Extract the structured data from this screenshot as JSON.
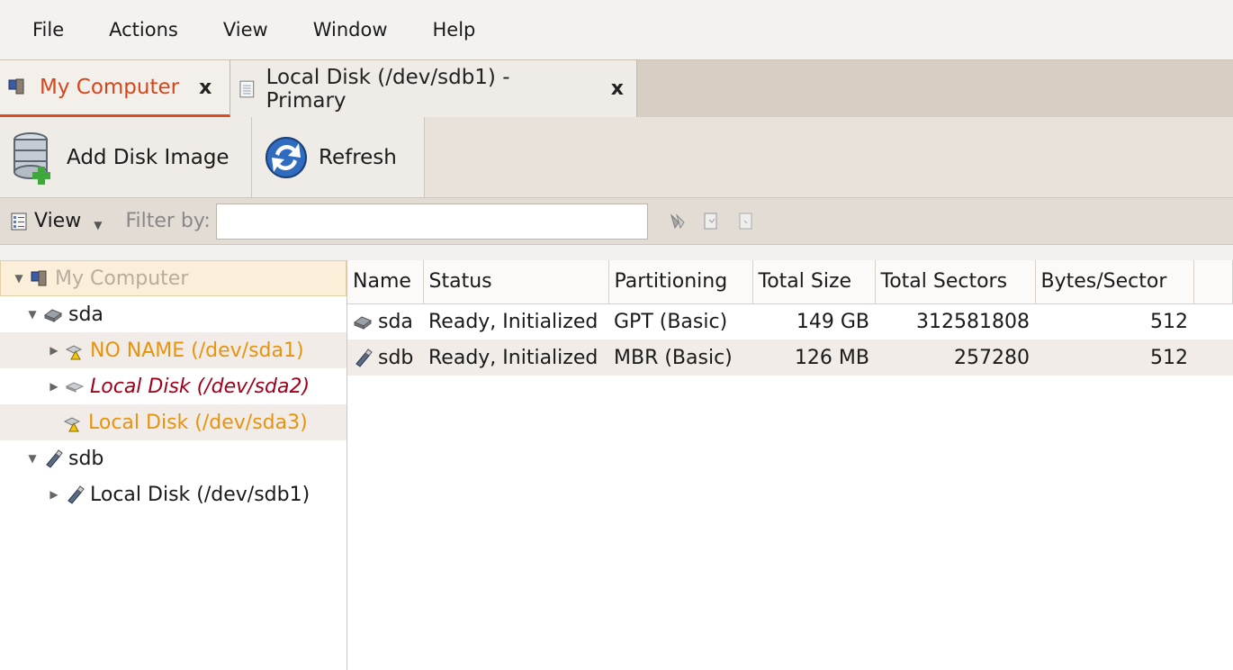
{
  "menu": {
    "items": [
      {
        "label": "File"
      },
      {
        "label": "Actions"
      },
      {
        "label": "View"
      },
      {
        "label": "Window"
      },
      {
        "label": "Help"
      }
    ]
  },
  "tabs": [
    {
      "label": "My Computer",
      "close": "x"
    },
    {
      "label": "Local Disk (/dev/sdb1) - Primary",
      "close": "x"
    }
  ],
  "toolbar": {
    "add_disk_image": "Add Disk Image",
    "refresh": "Refresh"
  },
  "filterbar": {
    "view_label": "View",
    "filter_label": "Filter by:",
    "filter_value": ""
  },
  "tree": {
    "root": "My Computer",
    "sda": "sda",
    "sda1": "NO NAME (/dev/sda1)",
    "sda2": "Local Disk (/dev/sda2)",
    "sda3": "Local Disk (/dev/sda3)",
    "sdb": "sdb",
    "sdb1": "Local Disk (/dev/sdb1)"
  },
  "table": {
    "headers": [
      "Name",
      "Status",
      "Partitioning",
      "Total Size",
      "Total Sectors",
      "Bytes/Sector"
    ],
    "rows": [
      {
        "name": "sda",
        "status": "Ready, Initialized",
        "partitioning": "GPT (Basic)",
        "size": "149 GB",
        "sectors": "312581808",
        "bytes": "512"
      },
      {
        "name": "sdb",
        "status": "Ready, Initialized",
        "partitioning": "MBR (Basic)",
        "size": "126 MB",
        "sectors": "257280",
        "bytes": "512"
      }
    ]
  },
  "colors": {
    "accent": "#e04a1c",
    "warning": "#e8930c",
    "error_text": "#a0001a"
  }
}
